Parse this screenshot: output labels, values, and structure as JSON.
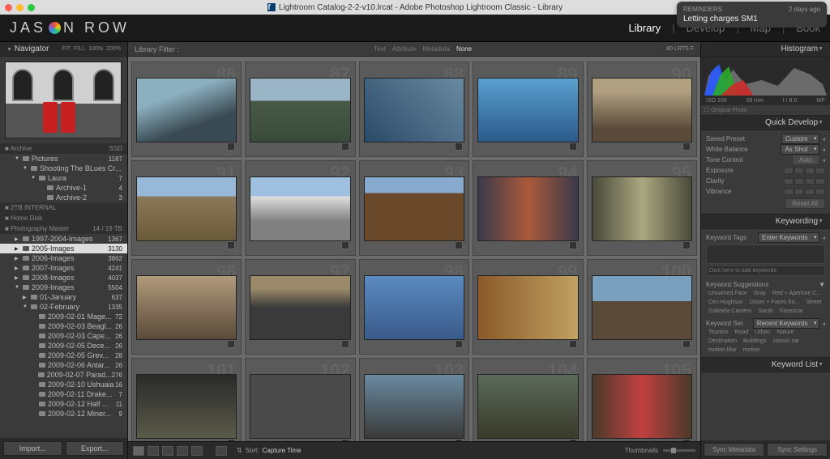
{
  "titlebar": {
    "title": "Lightroom Catalog-2-2-v10.lrcat - Adobe Photoshop Lightroom Classic - Library"
  },
  "notification": {
    "app": "REMINDERS",
    "time": "2 days ago",
    "body": "Letting charges SM1"
  },
  "brand": {
    "pre": "JAS",
    "post": "N ROW"
  },
  "modules": {
    "library": "Library",
    "develop": "Develop",
    "map": "Map",
    "book": "Book"
  },
  "navigator": {
    "title": "Navigator",
    "zooms": [
      "FIT",
      "FILL",
      "100%",
      "200%"
    ]
  },
  "folders": {
    "volumes": [
      {
        "name": "Archive",
        "info": "SSD"
      },
      {
        "name": "2TB INTERNAL",
        "info": ""
      },
      {
        "name": "Home Disk",
        "info": ""
      },
      {
        "name": "Photography Master",
        "info": "14 / 19 TB"
      }
    ],
    "pictures": {
      "name": "Pictures",
      "count": "1187"
    },
    "shooting": {
      "name": "Shooting The BLues Cr...",
      "count": ""
    },
    "laura": {
      "name": "Laura",
      "count": "7"
    },
    "archive1": {
      "name": "Archive-1",
      "count": "4"
    },
    "archive2": {
      "name": "Archive-2",
      "count": "3"
    },
    "years": [
      {
        "name": "1997-2004-Images",
        "count": "1367"
      },
      {
        "name": "2005-Images",
        "count": "3130",
        "selected": true
      },
      {
        "name": "2006-Images",
        "count": "3862"
      },
      {
        "name": "2007-Images",
        "count": "4241"
      },
      {
        "name": "2008-Images",
        "count": "4037"
      },
      {
        "name": "2009-Images",
        "count": "5504",
        "expanded": true
      }
    ],
    "months": [
      {
        "name": "01-January",
        "count": "637"
      },
      {
        "name": "02-February",
        "count": "1335",
        "expanded": true
      }
    ],
    "days": [
      {
        "name": "2009-02-01 Mage...",
        "count": "72"
      },
      {
        "name": "2009-02-03 Beagl...",
        "count": "26"
      },
      {
        "name": "2009-02-03 Cape...",
        "count": "26"
      },
      {
        "name": "2009-02-05 Dece...",
        "count": "26"
      },
      {
        "name": "2009-02-05 Grev...",
        "count": "28"
      },
      {
        "name": "2009-02-06 Antar...",
        "count": "26"
      },
      {
        "name": "2009-02-07 Parad...",
        "count": "276"
      },
      {
        "name": "2009-02-10 Ushuaia",
        "count": "16"
      },
      {
        "name": "2009-02-11 Drake...",
        "count": "7"
      },
      {
        "name": "2009-02-12 Half ...",
        "count": "11"
      },
      {
        "name": "2009-02-12 Miner...",
        "count": "9"
      }
    ],
    "import": "Import...",
    "export": "Export..."
  },
  "filter": {
    "label": "Library Filter :",
    "tabs": [
      "Text",
      "Attribute",
      "Metadata",
      "None"
    ],
    "preset": "80 LRTS F"
  },
  "grid": {
    "cells": [
      {
        "n": "86",
        "t": "t86"
      },
      {
        "n": "87",
        "t": "t87"
      },
      {
        "n": "88",
        "t": "t88"
      },
      {
        "n": "89",
        "t": "t89"
      },
      {
        "n": "90",
        "t": "t90"
      },
      {
        "n": "91",
        "t": "t91"
      },
      {
        "n": "92",
        "t": "t92"
      },
      {
        "n": "93",
        "t": "t93"
      },
      {
        "n": "94",
        "t": "t94"
      },
      {
        "n": "95",
        "t": "t95"
      },
      {
        "n": "96",
        "t": "t96"
      },
      {
        "n": "97",
        "t": "t97"
      },
      {
        "n": "98",
        "t": "t98"
      },
      {
        "n": "99",
        "t": "t99"
      },
      {
        "n": "100",
        "t": "t100"
      },
      {
        "n": "101",
        "t": "t101"
      },
      {
        "n": "102",
        "t": "t102"
      },
      {
        "n": "103",
        "t": "t103"
      },
      {
        "n": "104",
        "t": "t104"
      },
      {
        "n": "105",
        "t": "t105"
      }
    ]
  },
  "toolbar": {
    "sort_label": "Sort:",
    "sort_value": "Capture Time",
    "thumbnails": "Thumbnails"
  },
  "histogram": {
    "title": "Histogram",
    "iso": "ISO 100",
    "focal": "28 mm",
    "aperture": "f / 8.0",
    "shutter": "WF",
    "orig": "Original Photo"
  },
  "quickdev": {
    "title": "Quick Develop",
    "preset_label": "Saved Preset",
    "preset_value": "Custom",
    "wb_label": "White Balance",
    "wb_value": "As Shot",
    "tone_label": "Tone Control",
    "auto": "Auto",
    "exposure": "Exposure",
    "clarity": "Clarity",
    "vibrance": "Vibrance",
    "reset": "Reset All"
  },
  "keywording": {
    "title": "Keywording",
    "tags_label": "Keyword Tags",
    "tags_mode": "Enter Keywords",
    "placeholder": "Click here to add keywords",
    "suggestions_label": "Keyword Suggestions",
    "suggestions": [
      "Unnamed Face",
      "Gray",
      "Red + Aperture C...",
      "Cen Hughson",
      "Doser + Faces fro...",
      "Street",
      "Gabriela Cantero",
      "Sarah",
      "Facescar"
    ],
    "set_label": "Keyword Set",
    "set_value": "Recent Keywords",
    "recent": [
      "Tourism",
      "Road",
      "Urban",
      "Nature",
      "Destination",
      "Buildings",
      "classic car",
      "motion blur",
      "motion"
    ]
  },
  "keywordlist": {
    "title": "Keyword List"
  },
  "sync": {
    "meta": "Sync Metadata",
    "settings": "Sync Settings"
  }
}
